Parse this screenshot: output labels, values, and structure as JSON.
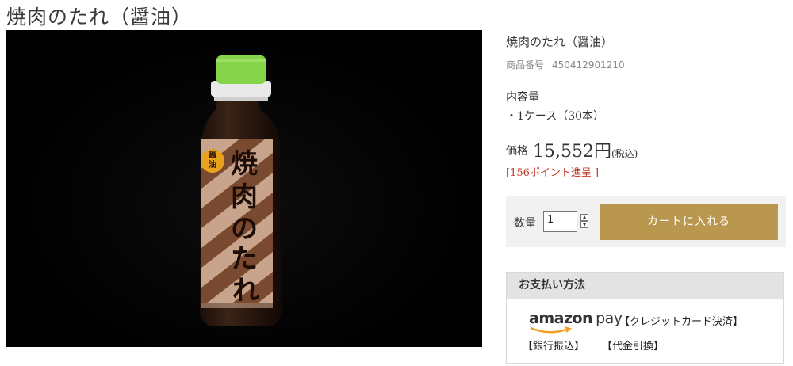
{
  "page_title": "焼肉のたれ（醤油）",
  "product": {
    "name": "焼肉のたれ（醤油）",
    "sku_label": "商品番号",
    "sku_value": "450412901210",
    "capacity_label": "内容量",
    "capacity_value": "・1ケース（30本）",
    "price_label": "価格",
    "price_value": "15,552円",
    "tax_note": "(税込)",
    "points": "[156ポイント進呈 ]"
  },
  "bottle_label": {
    "main_text": "焼肉のたれ",
    "badge_text": "醤油",
    "colors": {
      "cap": "#86d44a",
      "label_bg": "#c9a48c",
      "stripe": "#7a4a30",
      "badge": "#e8a21d"
    }
  },
  "cart": {
    "qty_label": "数量",
    "qty_value": "1",
    "spin_up": "▲",
    "spin_down": "▼",
    "button_label": "カートに入れる",
    "button_color": "#b9974f"
  },
  "payment": {
    "header": "お支払い方法",
    "amazon_logo_text": "amazon",
    "amazon_pay_text": "pay",
    "methods": [
      "【クレジットカード決済】",
      "【銀行振込】",
      "【代金引換】"
    ]
  }
}
